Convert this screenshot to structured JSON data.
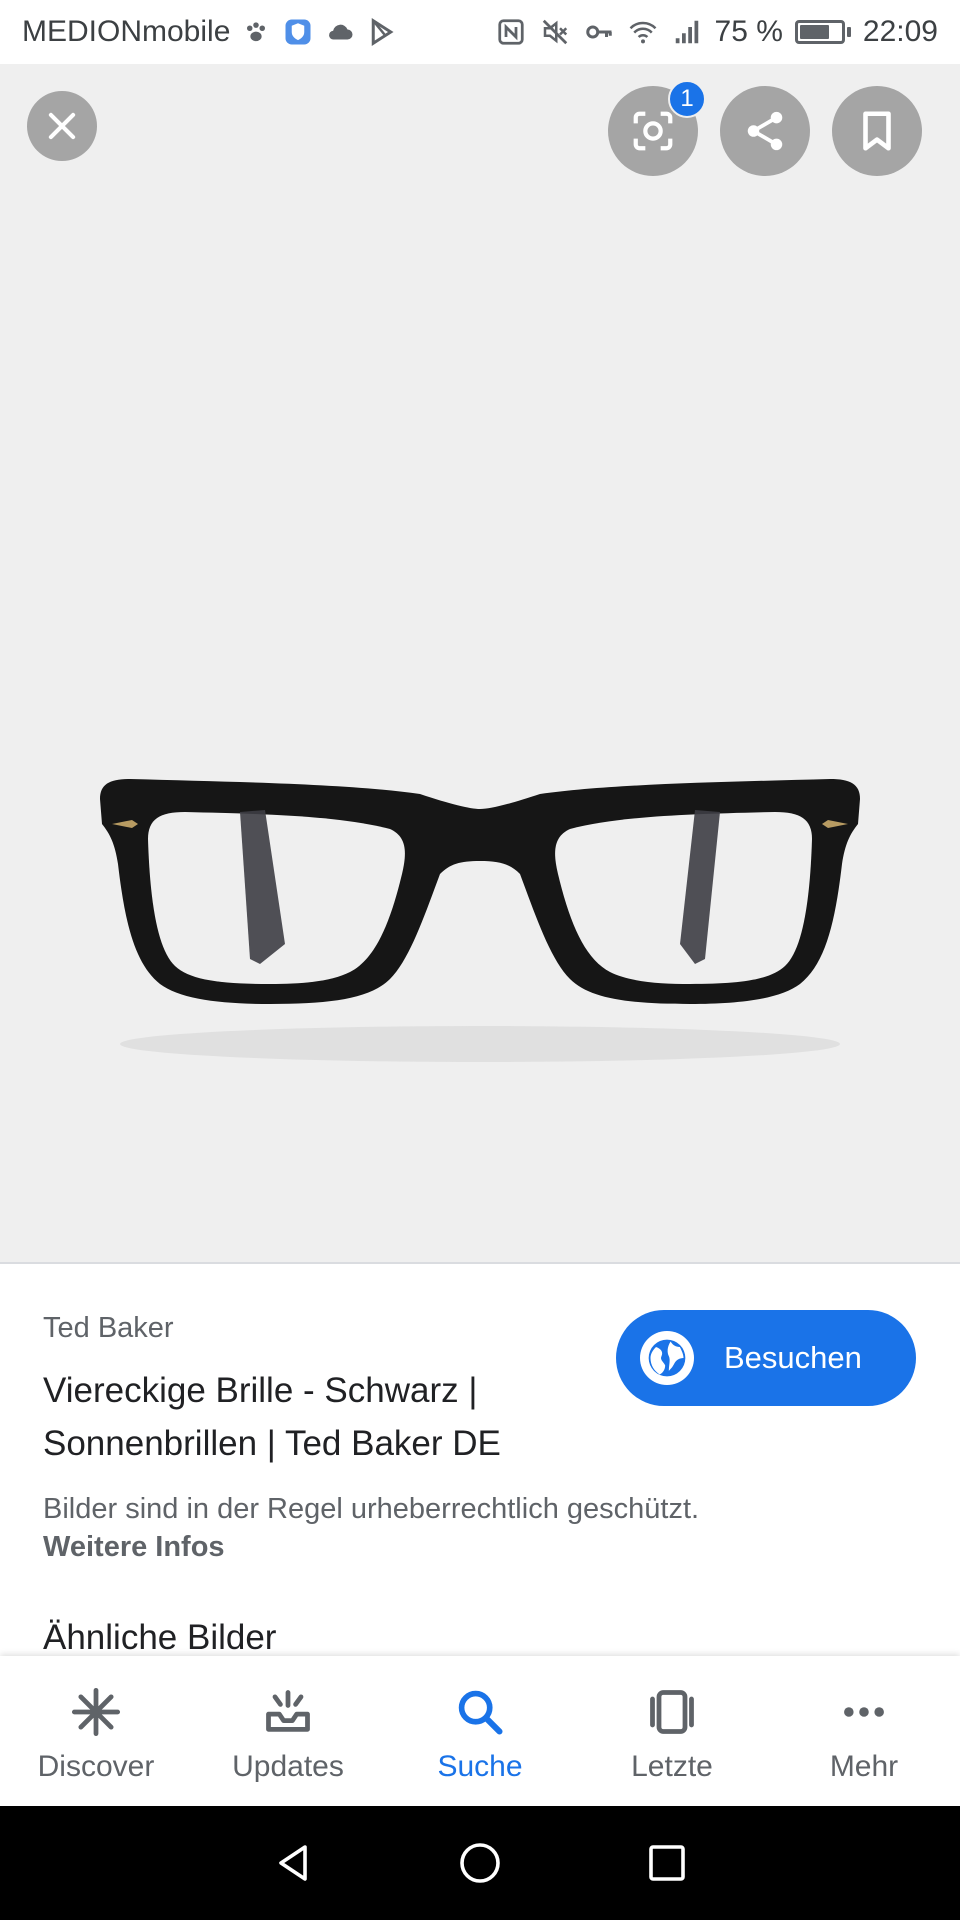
{
  "status_bar": {
    "carrier": "MEDIONmobile",
    "battery_text": "75 %",
    "battery_level": 0.75,
    "time": "22:09"
  },
  "image_toolbar": {
    "lens_badge_count": "1"
  },
  "result": {
    "source": "Ted Baker",
    "title": "Viereckige Brille - Schwarz | Sonnenbrillen | Ted Baker DE",
    "visit_label": "Besuchen",
    "copyright_notice": "Bilder sind in der Regel urheberrechtlich geschützt.",
    "more_info_link": "Weitere Infos",
    "similar_heading": "Ähnliche Bilder"
  },
  "bottom_nav": {
    "items": [
      {
        "label": "Discover",
        "icon": "asterisk-icon"
      },
      {
        "label": "Updates",
        "icon": "updates-tray-icon"
      },
      {
        "label": "Suche",
        "icon": "search-icon",
        "active": true
      },
      {
        "label": "Letzte",
        "icon": "recent-cards-icon"
      },
      {
        "label": "Mehr",
        "icon": "more-dots-icon"
      }
    ]
  },
  "colors": {
    "accent": "#1a73e8",
    "image_background": "#efefef",
    "text_primary": "#202124",
    "text_secondary": "#5f6368"
  }
}
